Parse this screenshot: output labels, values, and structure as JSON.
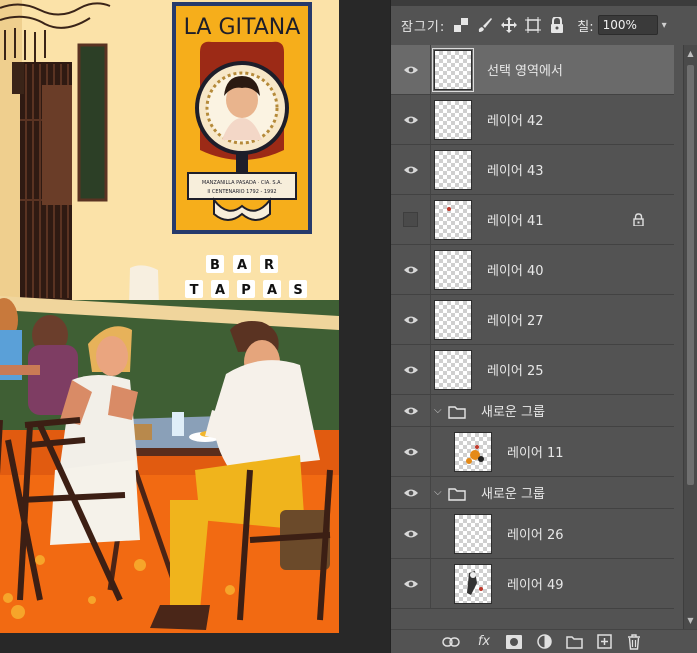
{
  "artwork": {
    "poster_title": "LA GITANA",
    "poster_caption_1": "MANZANILLA PASADA · CIA. S.A.",
    "poster_caption_2": "II CENTENARIO 1792 - 1992",
    "sign_line_1": [
      "B",
      "A",
      "R"
    ],
    "sign_line_2": [
      "T",
      "A",
      "P",
      "A",
      "S"
    ]
  },
  "lock_bar": {
    "label": "잠그기:",
    "fill_label": "칠:",
    "fill_value": "100%"
  },
  "layers": [
    {
      "name": "선택 영역에서",
      "visible": true,
      "selected": true
    },
    {
      "name": "레이어 42",
      "visible": true
    },
    {
      "name": "레이어 43",
      "visible": true
    },
    {
      "name": "레이어 41",
      "visible": false,
      "locked": true
    },
    {
      "name": "레이어 40",
      "visible": true
    },
    {
      "name": "레이어 27",
      "visible": true
    },
    {
      "name": "레이어 25",
      "visible": true
    },
    {
      "name": "새로운 그룹",
      "visible": true,
      "group": true
    },
    {
      "name": "레이어 11",
      "visible": true,
      "child": true
    },
    {
      "name": "새로운 그룹",
      "visible": true,
      "group": true
    },
    {
      "name": "레이어 26",
      "visible": true,
      "child": true
    },
    {
      "name": "레이어 49",
      "visible": true,
      "child": true
    }
  ],
  "icons": {
    "lock_bar": [
      "lock-transparent-pixels-icon",
      "lock-image-pixels-icon",
      "lock-position-icon",
      "lock-artboard-icon",
      "lock-all-icon"
    ],
    "bottom_bar": [
      "link-layers-icon",
      "layer-style-fx-icon",
      "add-mask-icon",
      "adjustment-layer-icon",
      "new-group-icon",
      "new-layer-icon",
      "delete-layer-icon"
    ],
    "fx_label": "fx"
  },
  "colors": {
    "panel_bg": "#535353",
    "selected_row": "#6a6a6a",
    "wall": "#fbe2a8",
    "poster_yellow": "#f6ae1b",
    "floor_orange": "#f26a12",
    "bench_green": "#3f5f34"
  }
}
